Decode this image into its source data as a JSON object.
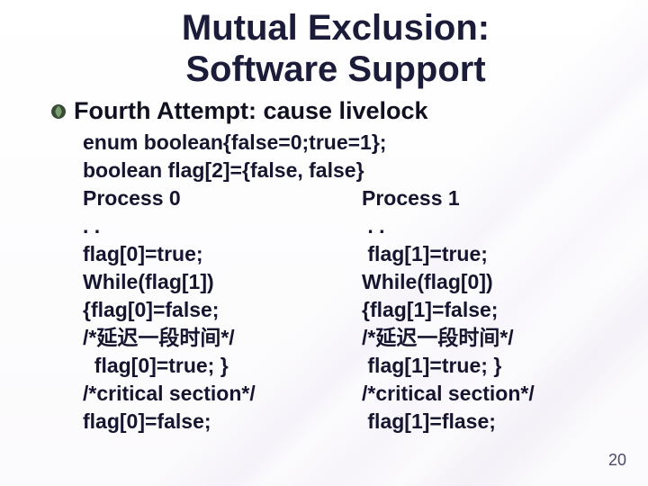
{
  "title_line1": "Mutual Exclusion:",
  "title_line2": "Software Support",
  "bullet": "Fourth Attempt: cause livelock",
  "decl_line1": "enum boolean{false=0;true=1};",
  "decl_line2": "boolean flag[2]={false, false}",
  "proc_left": "Process 0\n. .\nflag[0]=true;\nWhile(flag[1])\n{flag[0]=false;\n/*延迟一段时间*/\n  flag[0]=true; }\n/*critical section*/\nflag[0]=false;",
  "proc_right": "Process 1\n . .\n flag[1]=true;\nWhile(flag[0])\n{flag[1]=false;\n/*延迟一段时间*/\n flag[1]=true; }\n/*critical section*/\n flag[1]=flase;",
  "page_number": "20"
}
